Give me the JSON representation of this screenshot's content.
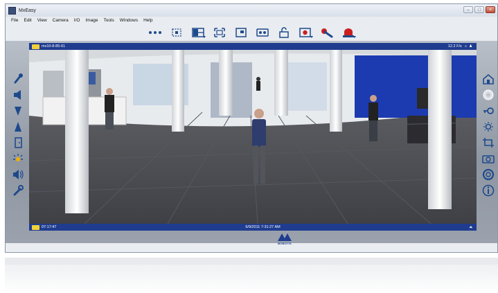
{
  "window": {
    "title": "MxEasy",
    "buttons": {
      "minimize": "–",
      "maximize": "□",
      "close": "×"
    }
  },
  "menu": [
    "File",
    "Edit",
    "View",
    "Camera",
    "I/O",
    "Image",
    "Tools",
    "Windows",
    "Help"
  ],
  "toolbar": {
    "icons": [
      "more-icon",
      "layout-select-icon",
      "multi-view-icon",
      "fullscreen-icon",
      "crop-icon",
      "recording-icon",
      "lock-icon",
      "record-dropdown-icon",
      "settings-wrench-icon",
      "alarm-icon"
    ]
  },
  "camera": {
    "name": "mx10-8-85-61",
    "frame_rate": "12.2 F/s",
    "time_left": "07:17:47",
    "timestamp": "6/9/2011 7:31:27 AM"
  },
  "left_tools": [
    "microphone-icon",
    "speaker-icon",
    "volume-down-icon",
    "volume-up-icon",
    "door-icon",
    "light-icon",
    "sound-alarm-icon",
    "wrench-icon"
  ],
  "right_tools": [
    "home-icon",
    "ptz-icon",
    "key-icon",
    "brightness-icon",
    "crop-icon",
    "camera-snapshot-icon",
    "lifebuoy-icon",
    "info-icon"
  ],
  "brand": {
    "name": "MOBOTIX"
  },
  "colors": {
    "accent": "#1f3c8f",
    "panel": "#e9ecf0",
    "camicon": "#f0d03a"
  }
}
